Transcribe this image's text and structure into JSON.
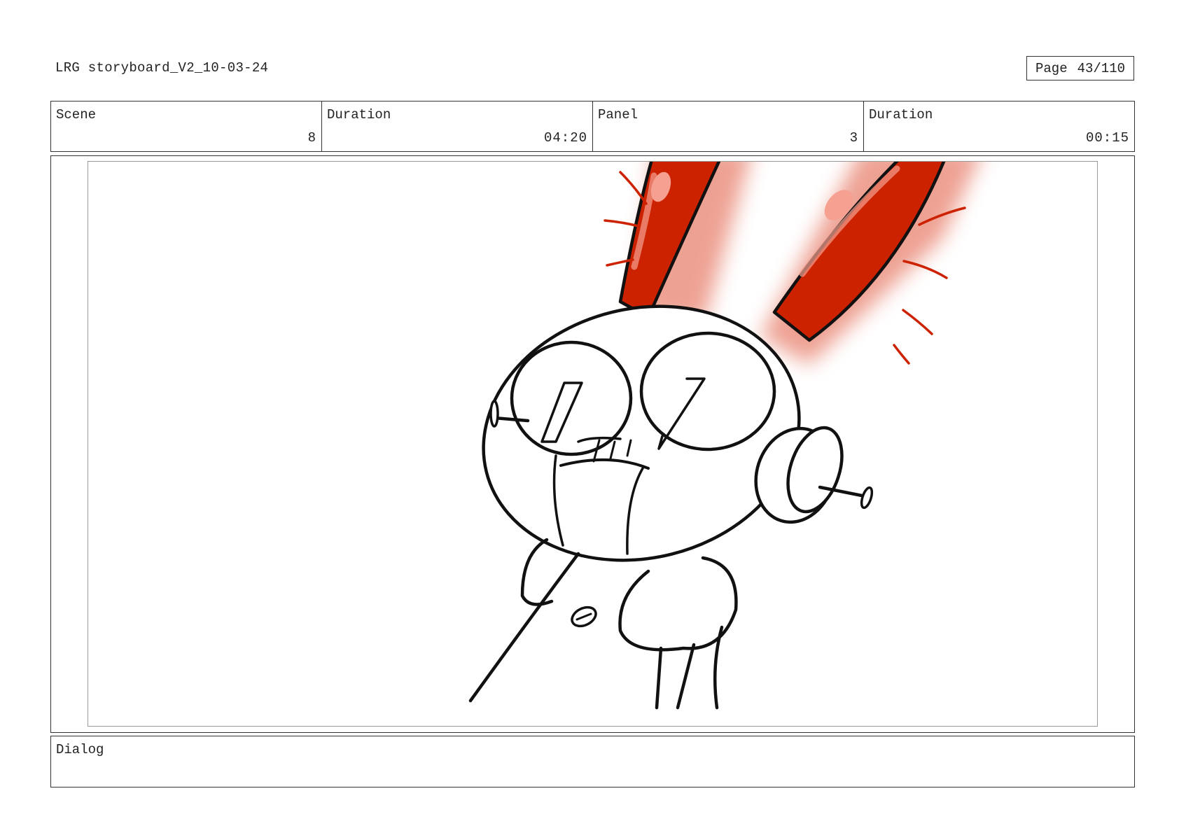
{
  "document": {
    "title": "LRG storyboard_V2_10-03-24",
    "page_label": "Page",
    "page_value": "43/110"
  },
  "info": {
    "scene_label": "Scene",
    "scene_value": "8",
    "scene_duration_label": "Duration",
    "scene_duration_value": "04:20",
    "panel_label": "Panel",
    "panel_value": "3",
    "panel_duration_label": "Duration",
    "panel_duration_value": "00:15"
  },
  "dialog": {
    "label": "Dialog",
    "text": ""
  },
  "colors": {
    "ears": "#cc2200",
    "ear_glow": "#e0553a",
    "highlight": "#f5a090",
    "ink": "#111111"
  }
}
